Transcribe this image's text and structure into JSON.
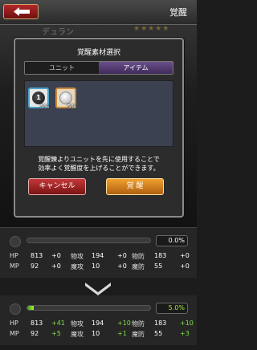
{
  "header": {
    "title": "覚醒"
  },
  "background": {
    "unit_name": "デュラン",
    "stars": "★★★★★"
  },
  "dialog": {
    "title": "覚醒素材選択",
    "tabs": [
      {
        "label": "ユニット",
        "active": false
      },
      {
        "label": "アイテム",
        "active": true
      }
    ],
    "items": [
      {
        "icon": "awakening-orb-black-icon",
        "number": "1",
        "rate": "5%"
      },
      {
        "icon": "awakening-orb-white-icon",
        "number": "",
        "rate": "5%"
      }
    ],
    "description_line1": "覚醒錬よりユニットを先に使用することで",
    "description_line2": "効率よく覚醒度を上げることができます。",
    "cancel_label": "キャンセル",
    "confirm_label": "覚 醒"
  },
  "before": {
    "rate": "0.0%",
    "progress": 0.0,
    "rows": [
      [
        {
          "label": "HP",
          "value": "813",
          "inc": "+0"
        },
        {
          "label": "物攻",
          "value": "194",
          "inc": "+0"
        },
        {
          "label": "物防",
          "value": "183",
          "inc": "+0"
        }
      ],
      [
        {
          "label": "MP",
          "value": "92",
          "inc": "+0"
        },
        {
          "label": "魔攻",
          "value": "10",
          "inc": "+0"
        },
        {
          "label": "魔防",
          "value": "55",
          "inc": "+0"
        }
      ]
    ]
  },
  "after": {
    "rate": "5.0%",
    "progress": 0.05,
    "rows": [
      [
        {
          "label": "HP",
          "value": "813",
          "inc": "+41"
        },
        {
          "label": "物攻",
          "value": "194",
          "inc": "+10"
        },
        {
          "label": "物防",
          "value": "183",
          "inc": "+10"
        }
      ],
      [
        {
          "label": "MP",
          "value": "92",
          "inc": "+5"
        },
        {
          "label": "魔攻",
          "value": "10",
          "inc": "+1"
        },
        {
          "label": "魔防",
          "value": "55",
          "inc": "+3"
        }
      ]
    ]
  },
  "colors": {
    "accent_green": "#7ee04a",
    "cancel_red": "#c43838",
    "confirm_orange": "#f0a030",
    "tab_purple": "#6a4f8a"
  }
}
